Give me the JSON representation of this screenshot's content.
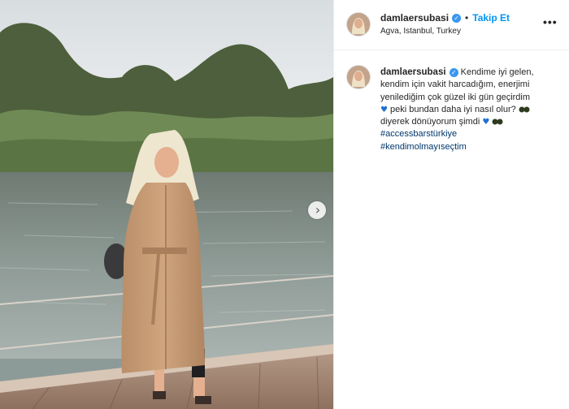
{
  "account": {
    "username": "damlaersubasi",
    "verified": true,
    "location": "Agva, Istanbul, Turkey"
  },
  "header": {
    "separator": "•",
    "follow_label": "Takip Et",
    "more_label": "•••"
  },
  "caption": {
    "line1": "Kendime iyi gelen,",
    "line2": "kendim için vakit harcadığım, enerjimi",
    "line3": "yenilediğim çok güzel iki gün geçirdim",
    "line4": "peki bundan daha iyi nasıl olur?",
    "line5": "diyerek dönüyorum şimdi",
    "hashtags": [
      "#accessbarstürkiye",
      "#kendimolmayıseçtim"
    ]
  },
  "icons": {
    "verified": "verified-badge-icon",
    "heart": "blue-heart-emoji",
    "sunglasses": "sunglasses-emoji",
    "next": "chevron-right-icon",
    "more": "more-options-icon"
  },
  "colors": {
    "follow": "#0095f6",
    "verified": "#3897f0",
    "hashtag": "#00376b"
  }
}
